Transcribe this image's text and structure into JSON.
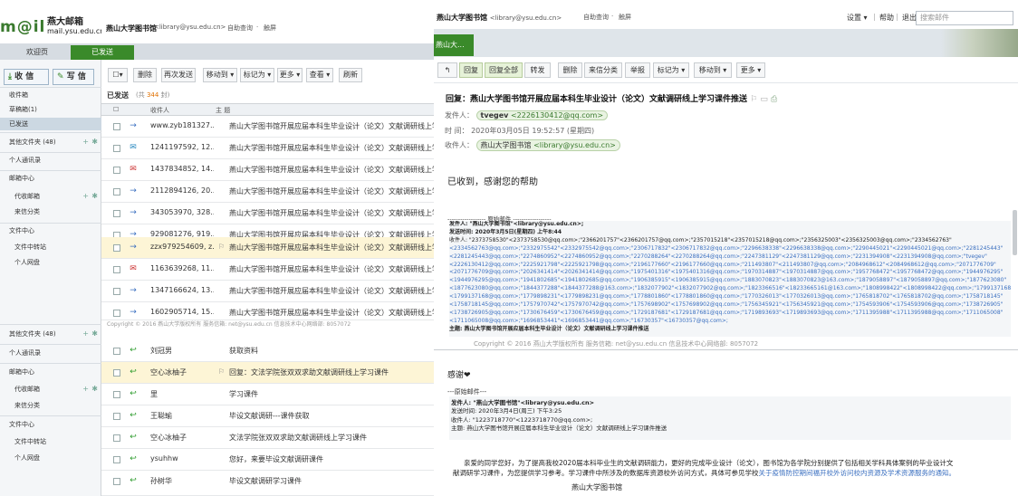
{
  "left": {
    "brand": {
      "logo_text": "m@il",
      "name": "燕大邮箱",
      "domain": "mail.ysu.edu.cn"
    },
    "header": {
      "title": "燕山大学图书馆",
      "email": "<library@ysu.edu.cn>",
      "links": [
        "自助查询",
        "·",
        "触屏"
      ]
    },
    "tabs": [
      "欢迎页",
      "已发送"
    ],
    "compose": {
      "receive_label": "收 信",
      "write_label": "写 信"
    },
    "nav": [
      {
        "label": "收件箱"
      },
      {
        "label": "草稿箱(1)"
      },
      {
        "label": "已发送"
      },
      {
        "label": "其他文件夹 (48)"
      },
      {
        "label": "个人通讯录"
      },
      {
        "label": "邮箱中心"
      },
      {
        "label": "代收邮箱"
      },
      {
        "label": "来信分类"
      },
      {
        "label": "文件中心"
      },
      {
        "label": "文件中转站"
      },
      {
        "label": "个人网盘"
      }
    ],
    "nav_dup": [
      {
        "label": "其他文件夹 (48)"
      },
      {
        "label": "个人通讯录"
      },
      {
        "label": "邮箱中心"
      },
      {
        "label": "代收邮箱"
      },
      {
        "label": "来信分类"
      },
      {
        "label": "文件中心"
      },
      {
        "label": "文件中转站"
      },
      {
        "label": "个人网盘"
      }
    ],
    "toolbar": [
      "删除",
      "再次发送",
      "移动到 ▾",
      "标记为 ▾",
      "更多 ▾",
      "查看 ▾",
      "刷新"
    ],
    "folder_title": "已发送",
    "count_prefix": "(共 ",
    "count": "344",
    "count_suffix": " 封)",
    "columns": {
      "sender": "收件人",
      "subject": "主 题"
    },
    "rows": [
      {
        "sender": "www.zyb181327...",
        "subject": "燕山大学图书馆开展应届本科生毕业设计（论文）文献调研线上学习课件推送",
        "icon": "→"
      },
      {
        "sender": "1241197592, 12...",
        "subject": "燕山大学图书馆开展应届本科生毕业设计（论文）文献调研线上学习课件推送",
        "icon": "✉"
      },
      {
        "sender": "1437834852, 14...",
        "subject": "燕山大学图书馆开展应届本科生毕业设计（论文）文献调研线上学习课件推送",
        "icon": "✉"
      },
      {
        "sender": "2112894126, 20...",
        "subject": "燕山大学图书馆开展应届本科生毕业设计（论文）文献调研线上学习课件推送",
        "icon": "→"
      },
      {
        "sender": "343053970, 328...",
        "subject": "燕山大学图书馆开展应届本科生毕业设计（论文）文献调研线上学习课件推送",
        "icon": "→"
      },
      {
        "sender": "929081276, 919...",
        "subject": "燕山大学图书馆开展应届本科生毕业设计（论文）文献调研线上学习课件推送",
        "icon": "→"
      },
      {
        "sender": "zzx979254609, z...",
        "subject": "燕山大学图书馆开展应届本科生毕业设计（论文）文献调研线上学习课件推送",
        "icon": "→"
      },
      {
        "sender": "1163639268, 11...",
        "subject": "燕山大学图书馆开展应届本科生毕业设计（论文）文献调研线上学习课件推送",
        "icon": "✉"
      },
      {
        "sender": "1347166624, 13...",
        "subject": "燕山大学图书馆开展应届本科生毕业设计（论文）文献调研线上学习课件推送",
        "icon": "→"
      },
      {
        "sender": "1602905714, 15...",
        "subject": "燕山大学图书馆开展应届本科生毕业设计（论文）文献调研线上学习课件推送",
        "icon": "→"
      }
    ],
    "copyright": "Copyright © 2016 燕山大学版权所有 服务信箱: net@ysu.edu.cn 信息技术中心网络部: 8057072",
    "rows2": [
      {
        "sender": "刘冠男",
        "subject": "获取资料",
        "icon": "↩"
      },
      {
        "sender": "空心冰柚子",
        "subject": "回复：文法学院张双双求助文献调研线上学习课件",
        "icon": "↩"
      },
      {
        "sender": "里",
        "subject": "学习课件",
        "icon": "↩"
      },
      {
        "sender": "王聪瑜",
        "subject": "毕设文献调研---课件获取",
        "icon": "↩"
      },
      {
        "sender": "空心冰柚子",
        "subject": "文法学院张双双求助文献调研线上学习课件",
        "icon": "↩"
      },
      {
        "sender": "ysuhhw",
        "subject": "您好，来要毕设文献调研课件",
        "icon": "↩"
      },
      {
        "sender": "孙树华",
        "subject": "毕设文献调研学习课件",
        "icon": "↩"
      }
    ]
  },
  "right": {
    "header": {
      "title": "燕山大学图书馆",
      "email": "<library@ysu.edu.cn>",
      "links": [
        "自助查询",
        "·",
        "触屏"
      ]
    },
    "top_links": [
      "设置 ▾",
      "|",
      "帮助",
      "|",
      "退出"
    ],
    "search_placeholder": "搜索邮件",
    "tab": "燕山大...",
    "toolbar": [
      "↰",
      "回复",
      "回复全部",
      "转发",
      "删除",
      "来信分类",
      "举报",
      "标记为 ▾",
      "移动到 ▾",
      "更多 ▾"
    ],
    "subject": "回复：燕山大学图书馆开展应届本科生毕业设计（论文）文献调研线上学习课件推送",
    "from_label": "发件人：",
    "from_name": "tvegev",
    "from_addr": "<2226130412@qq.com>",
    "time_label": "时  间：",
    "time": "2020年03月05日 19:52:57 (星期四)",
    "to_label": "收件人：",
    "to_name": "燕山大学图书馆",
    "to_addr": "<library@ysu.edu.cn>",
    "body1": "已收到，感谢您的帮助",
    "orig_label": "------------------ 原始邮件 ------------------",
    "quote1": [
      "发件人: \"燕山大学图书馆\"<library@ysu.edu.cn>;",
      "发送时间: 2020年3月5日(星期四) 上午8:44",
      "收件人: \"2373758530\"<2373758530@qq.com>;\"2366201757\"<2366201757@qq.com>;\"2357015218\"<2357015218@qq.com>;\"2356325003\"<2356325003@qq.com>;\"2334562763\"",
      "<2334562763@qq.com>;\"2332975542\"<2332975542@qq.com>;\"2306717832\"<2306717832@qq.com>;\"2296638338\"<2296638338@qq.com>;\"2290445021\"<2290445021@qq.com>;\"2281245443\"",
      "<2281245443@qq.com>;\"2274860952\"<2274860952@qq.com>;\"2270288264\"<2270288264@qq.com>;\"2247381129\"<2247381129@qq.com>;\"2231394908\"<2231394908@qq.com>;\"tvegev\"",
      "<2226130412@qq.com>;\"2225921798\"<2225921798@qq.com>;\"2196177660\"<2196177660@qq.com>;\"211493807\"<211493807@qq.com>;\"2084968612\"<2084968612@qq.com>;\"2071776709\"",
      "<2071776709@qq.com>;\"2026341414\"<2026341414@qq.com>;\"1975401316\"<1975401316@qq.com>;\"1970314887\"<1970314887@qq.com>;\"1957768472\"<1957768472@qq.com>;\"1944976295\"",
      "<1944976295@qq.com>;\"1941802685\"<1941802685@qq.com>;\"1906385915\"<1906385915@qq.com>;\"1883070823\"<1883070823@163.com>;\"1879058897\"<1879058897@qq.com>;\"1877623080\"",
      "<1877623080@qq.com>;\"1844377288\"<1844377288@163.com>;\"1832077902\"<1832077902@qq.com>;\"1823366516\"<18233665161@163.com>;\"1808998422\"<1808998422@qq.com>;\"1799137168\"",
      "<1799137168@qq.com>;\"1779898231\"<1779898231@qq.com>;\"1778801860\"<1778801860@qq.com>;\"1770326013\"<1770326013@qq.com>;\"1765818702\"<1765818702@qq.com>;\"1758718145\"",
      "<1758718145@qq.com>;\"1757970742\"<1757970742@qq.com>;\"1757698902\"<1757698902@qq.com>;\"1756345921\"<1756345921@qq.com>;\"1754593906\"<1754593906@qq.com>;\"1738726905\"",
      "<1738726905@qq.com>;\"1730676459\"<1730676459@qq.com>;\"1729187681\"<1729187681@qq.com>;\"1719893693\"<1719893693@qq.com>;\"1711395988\"<1711395988@qq.com>;\"1711065008\"",
      "<1711065008@qq.com>;\"1696853441\"<1696853441@qq.com>;\"16730357\"<16730357@qq.com>;",
      "主题: 燕山大学图书馆开展应届本科生毕业设计（论文）文献调研线上学习课件推送"
    ],
    "copyright": "Copyright © 2016 燕山大学版权所有 服务信箱: net@ysu.edu.cn 信息技术中心网络部: 8057072",
    "body2": "感谢❤",
    "orig2_label": "---原始邮件---",
    "quote2": [
      "发件人: \"燕山大学图书馆\"<library@ysu.edu.cn>",
      "发送时间: 2020年3月4日(周三) 下午3:25",
      "收件人: \"1223718770\"<1223718770@qq.com>;",
      "主题: 燕山大学图书馆开展应届本科生毕业设计（论文）文献调研线上学习课件推送"
    ],
    "para1": "亲爱的同学您好，为了提高我校2020届本科毕业生的文献调研能力，更好的完成毕业设计（论文），图书馆为各学院分别提供了包括相关学科具体案例的毕业设计文",
    "para2": "献调研学习课件，为您提供学习参考。学习课件中所涉及的数据库资源校外访问方式，具体可参见学校",
    "para2_link": "关于疫情防控期间福开校外访问校内资源及学术资源服务的通知。",
    "signature": "燕山大学图书馆"
  }
}
